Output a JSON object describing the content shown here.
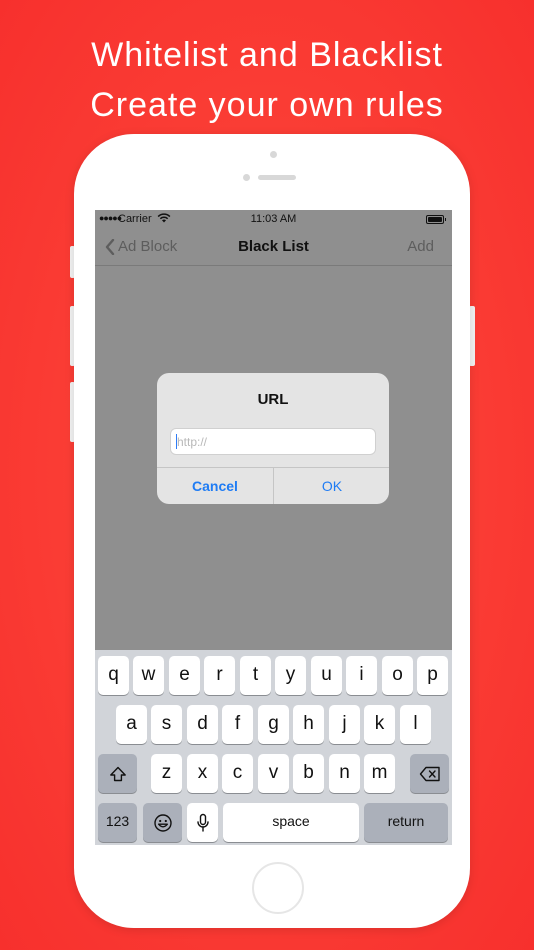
{
  "headline": {
    "line1": "Whitelist and Blacklist",
    "line2": "Create your own rules"
  },
  "status_bar": {
    "carrier": "Carrier",
    "time": "11:03 AM"
  },
  "nav": {
    "back_label": "Ad Block",
    "title": "Black List",
    "add_label": "Add"
  },
  "dialog": {
    "title": "URL",
    "input_placeholder": "http://",
    "input_value": "",
    "cancel_label": "Cancel",
    "ok_label": "OK"
  },
  "keyboard": {
    "row1": [
      "q",
      "w",
      "e",
      "r",
      "t",
      "y",
      "u",
      "i",
      "o",
      "p"
    ],
    "row2": [
      "a",
      "s",
      "d",
      "f",
      "g",
      "h",
      "j",
      "k",
      "l"
    ],
    "row3": [
      "z",
      "x",
      "c",
      "v",
      "b",
      "n",
      "m"
    ],
    "numbers_label": "123",
    "space_label": "space",
    "return_label": "return",
    "icons": {
      "shift": "shift-icon",
      "delete": "backspace-icon",
      "emoji": "emoji-icon",
      "mic": "microphone-icon"
    }
  },
  "colors": {
    "background": "#f7302d",
    "accent_blue": "#1f7cf4",
    "dim_overlay": "#8f8f8f"
  }
}
